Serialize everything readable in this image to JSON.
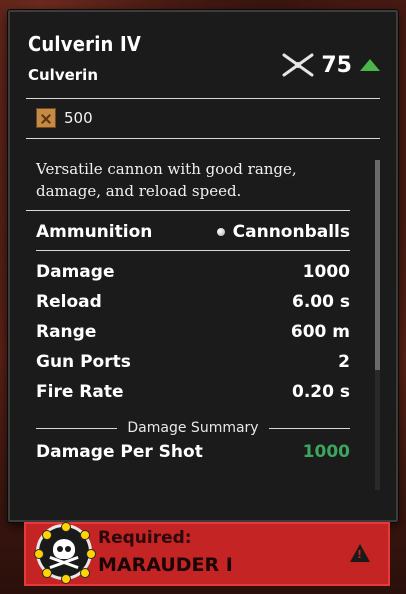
{
  "item": {
    "name": "Culverin IV",
    "type": "Culverin",
    "level": "75",
    "level_trend": "up",
    "cost": "500",
    "cost_icon": "wood-crate-icon",
    "description": "Versatile cannon with good range, damage, and reload speed."
  },
  "stats": {
    "ammunition": {
      "label": "Ammunition",
      "value": "Cannonballs",
      "icon": "cannonball-icon"
    },
    "damage": {
      "label": "Damage",
      "value": "1000"
    },
    "reload": {
      "label": "Reload",
      "value": "6.00 s"
    },
    "range": {
      "label": "Range",
      "value": "600 m"
    },
    "gun_ports": {
      "label": "Gun Ports",
      "value": "2"
    },
    "fire_rate": {
      "label": "Fire Rate",
      "value": "0.20 s"
    }
  },
  "summary": {
    "heading": "Damage Summary",
    "damage_per_shot": {
      "label": "Damage Per Shot",
      "value": "1000"
    }
  },
  "requirement": {
    "label": "Required:",
    "value": "MARAUDER I",
    "icon": "skull-crossbones-icon"
  },
  "colors": {
    "panel_bg": "#1b1b1b",
    "accent_green": "#3ca65e",
    "level_arrow": "#49b649",
    "requirement_bg": "#c52424"
  }
}
